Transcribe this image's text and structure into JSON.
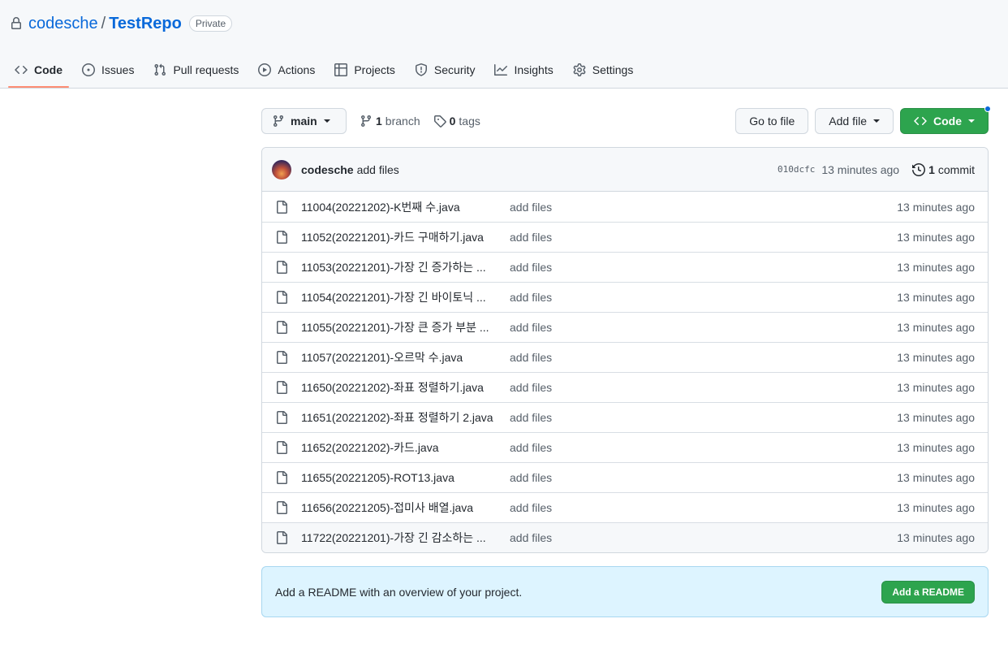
{
  "repo": {
    "owner": "codesche",
    "separator": "/",
    "name": "TestRepo",
    "visibility": "Private"
  },
  "tabs": [
    {
      "label": "Code",
      "icon": "code-icon",
      "active": true
    },
    {
      "label": "Issues",
      "icon": "issue-icon"
    },
    {
      "label": "Pull requests",
      "icon": "pull-request-icon"
    },
    {
      "label": "Actions",
      "icon": "play-icon"
    },
    {
      "label": "Projects",
      "icon": "table-icon"
    },
    {
      "label": "Security",
      "icon": "shield-icon"
    },
    {
      "label": "Insights",
      "icon": "graph-icon"
    },
    {
      "label": "Settings",
      "icon": "gear-icon"
    }
  ],
  "toolbar": {
    "branch": "main",
    "branch_count": "1",
    "branch_label": "branch",
    "tag_count": "0",
    "tag_label": "tags",
    "go_to_file": "Go to file",
    "add_file": "Add file",
    "code": "Code"
  },
  "commit": {
    "author": "codesche",
    "message": "add files",
    "sha": "010dcfc",
    "time": "13 minutes ago",
    "count": "1",
    "count_label": "commit"
  },
  "files": [
    {
      "name": "11004(20221202)-K번째 수.java",
      "message": "add files",
      "time": "13 minutes ago"
    },
    {
      "name": "11052(20221201)-카드 구매하기.java",
      "message": "add files",
      "time": "13 minutes ago"
    },
    {
      "name": "11053(20221201)-가장 긴 증가하는 ...",
      "message": "add files",
      "time": "13 minutes ago"
    },
    {
      "name": "11054(20221201)-가장 긴 바이토닉 ...",
      "message": "add files",
      "time": "13 minutes ago"
    },
    {
      "name": "11055(20221201)-가장 큰 증가 부분 ...",
      "message": "add files",
      "time": "13 minutes ago"
    },
    {
      "name": "11057(20221201)-오르막 수.java",
      "message": "add files",
      "time": "13 minutes ago"
    },
    {
      "name": "11650(20221202)-좌표 정렬하기.java",
      "message": "add files",
      "time": "13 minutes ago"
    },
    {
      "name": "11651(20221202)-좌표 정렬하기 2.java",
      "message": "add files",
      "time": "13 minutes ago"
    },
    {
      "name": "11652(20221202)-카드.java",
      "message": "add files",
      "time": "13 minutes ago"
    },
    {
      "name": "11655(20221205)-ROT13.java",
      "message": "add files",
      "time": "13 minutes ago"
    },
    {
      "name": "11656(20221205)-접미사 배열.java",
      "message": "add files",
      "time": "13 minutes ago"
    },
    {
      "name": "11722(20221201)-가장 긴 감소하는 ...",
      "message": "add files",
      "time": "13 minutes ago"
    }
  ],
  "readme": {
    "text": "Add a README with an overview of your project.",
    "button": "Add a README"
  }
}
